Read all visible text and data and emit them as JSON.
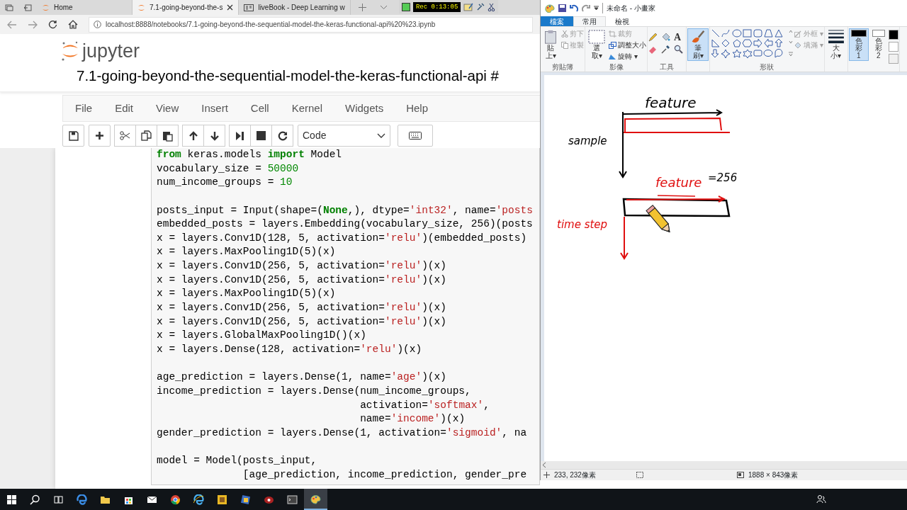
{
  "browser": {
    "tabs": [
      {
        "title": "Home",
        "selected": false,
        "kind": "jupyter"
      },
      {
        "title": "7.1-going-beyond-the-s",
        "selected": true,
        "kind": "jupyter"
      },
      {
        "title": "liveBook - Deep Learning w",
        "selected": false,
        "kind": "book"
      }
    ],
    "address": "localhost:8888/notebooks/7.1-going-beyond-the-sequential-model-the-keras-functional-api%20%23.ipynb"
  },
  "recorder": {
    "time": "Rec 0:13:05"
  },
  "notebook": {
    "logo": "jupyter",
    "title": "7.1-going-beyond-the-sequential-model-the-keras-functional-api #",
    "menu": [
      "File",
      "Edit",
      "View",
      "Insert",
      "Cell",
      "Kernel",
      "Widgets",
      "Help"
    ],
    "cell_type": "Code",
    "code": [
      {
        "segments": [
          {
            "text": "from",
            "kind": "keyword"
          },
          {
            "text": " keras.models "
          },
          {
            "text": "import",
            "kind": "keyword"
          },
          {
            "text": " Model"
          }
        ]
      },
      {
        "segments": [
          {
            "text": "vocabulary_size = "
          },
          {
            "text": "50000",
            "kind": "number"
          }
        ]
      },
      {
        "segments": [
          {
            "text": "num_income_groups = "
          },
          {
            "text": "10",
            "kind": "number"
          }
        ]
      },
      {
        "blank_line_before": true,
        "segments": [
          {
            "text": "posts_input = Input(shape=("
          },
          {
            "text": "None",
            "kind": "keyword"
          },
          {
            "text": ",), dtype="
          },
          {
            "text": "'int32'",
            "kind": "string"
          },
          {
            "text": ", name="
          },
          {
            "text": "'posts",
            "kind": "string"
          }
        ]
      },
      {
        "segments": [
          {
            "text": "embedded_posts = layers.Embedding(vocabulary_size, 256)(posts"
          }
        ]
      },
      {
        "segments": [
          {
            "text": "x = layers.Conv1D(128, 5, activation="
          },
          {
            "text": "'relu'",
            "kind": "string"
          },
          {
            "text": ")(embedded_posts)"
          }
        ]
      },
      {
        "segments": [
          {
            "text": "x = layers.MaxPooling1D(5)(x)"
          }
        ]
      },
      {
        "segments": [
          {
            "text": "x = layers.Conv1D(256, 5, activation="
          },
          {
            "text": "'relu'",
            "kind": "string"
          },
          {
            "text": ")(x)"
          }
        ]
      },
      {
        "segments": [
          {
            "text": "x = layers.Conv1D(256, 5, activation="
          },
          {
            "text": "'relu'",
            "kind": "string"
          },
          {
            "text": ")(x)"
          }
        ]
      },
      {
        "segments": [
          {
            "text": "x = layers.MaxPooling1D(5)(x)"
          }
        ]
      },
      {
        "segments": [
          {
            "text": "x = layers.Conv1D(256, 5, activation="
          },
          {
            "text": "'relu'",
            "kind": "string"
          },
          {
            "text": ")(x)"
          }
        ]
      },
      {
        "segments": [
          {
            "text": "x = layers.Conv1D(256, 5, activation="
          },
          {
            "text": "'relu'",
            "kind": "string"
          },
          {
            "text": ")(x)"
          }
        ]
      },
      {
        "segments": [
          {
            "text": "x = layers.GlobalMaxPooling1D()(x)"
          }
        ]
      },
      {
        "segments": [
          {
            "text": "x = layers.Dense(128, activation="
          },
          {
            "text": "'relu'",
            "kind": "string"
          },
          {
            "text": ")(x)"
          }
        ]
      },
      {
        "blank_line_before": true,
        "segments": [
          {
            "text": "age_prediction = layers.Dense(1, name="
          },
          {
            "text": "'age'",
            "kind": "string"
          },
          {
            "text": ")(x)"
          }
        ]
      },
      {
        "segments": [
          {
            "text": "income_prediction = layers.Dense(num_income_groups,"
          }
        ]
      },
      {
        "segments": [
          {
            "text": "                                 activation="
          },
          {
            "text": "'softmax'",
            "kind": "string"
          },
          {
            "text": ","
          }
        ]
      },
      {
        "segments": [
          {
            "text": "                                 name="
          },
          {
            "text": "'income'",
            "kind": "string"
          },
          {
            "text": ")(x)"
          }
        ]
      },
      {
        "segments": [
          {
            "text": "gender_prediction = layers.Dense(1, activation="
          },
          {
            "text": "'sigmoid'",
            "kind": "string"
          },
          {
            "text": ", na"
          }
        ]
      },
      {
        "blank_line_before": true,
        "segments": [
          {
            "text": "model = Model(posts_input,"
          }
        ]
      },
      {
        "segments": [
          {
            "text": "              [age_prediction, income_prediction, gender_pre"
          }
        ]
      }
    ]
  },
  "paint": {
    "title": "未命名 - 小畫家",
    "tabs": [
      {
        "label": "檔案",
        "kind": "file",
        "selected": false
      },
      {
        "label": "常用",
        "kind": "tab",
        "selected": true
      },
      {
        "label": "檢視",
        "kind": "tab",
        "selected": false
      }
    ],
    "clipboard": {
      "group": "剪貼簿",
      "paste": "貼上▾",
      "items": [
        {
          "label": "剪下",
          "disabled": true
        },
        {
          "label": "複製",
          "disabled": true
        }
      ]
    },
    "image": {
      "group": "影像",
      "select": "選取▾",
      "items": [
        {
          "label": "裁剪",
          "disabled": true
        },
        {
          "label": "調整大小",
          "disabled": false
        },
        {
          "label": "旋轉 ▾",
          "disabled": false
        }
      ]
    },
    "tools": {
      "group": "工具",
      "text_tool": "A"
    },
    "brush": {
      "label": "筆刷▾",
      "selected": true
    },
    "shapes": {
      "group": "形狀",
      "options": [
        {
          "label": "外框 ▾",
          "disabled": true
        },
        {
          "label": "填滿 ▾",
          "disabled": true
        }
      ]
    },
    "size": {
      "label": "大小▾"
    },
    "colors": [
      {
        "label": "色彩 1",
        "color": "#000000",
        "selected": true
      },
      {
        "label": "色彩 2",
        "color": "#ffffff",
        "selected": false
      }
    ],
    "sketch": {
      "labels": [
        {
          "text": "feature",
          "color": "#000000"
        },
        {
          "text": "sample",
          "color": "#000000"
        },
        {
          "text": "feature",
          "color": "#e01010"
        },
        {
          "text": "=256",
          "color": "#000000"
        },
        {
          "text": "time step",
          "color": "#e01010"
        }
      ]
    },
    "status": {
      "cursor": "233, 232像素",
      "canvas_size": "1888 × 843像素"
    }
  }
}
